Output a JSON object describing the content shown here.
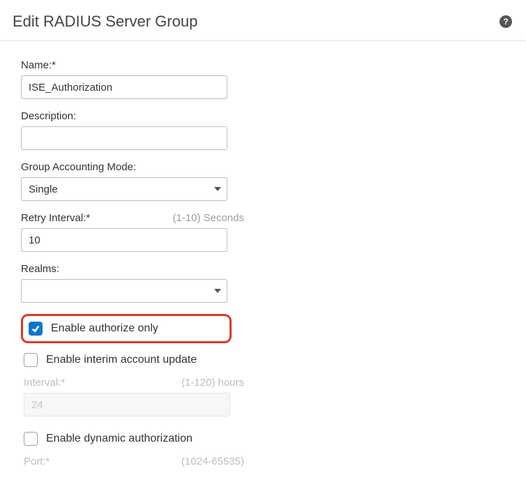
{
  "header": {
    "title": "Edit RADIUS Server Group"
  },
  "fields": {
    "name": {
      "label": "Name:*",
      "value": "ISE_Authorization"
    },
    "description": {
      "label": "Description:",
      "value": ""
    },
    "accounting": {
      "label": "Group Accounting Mode:",
      "value": "Single"
    },
    "retry": {
      "label": "Retry Interval:*",
      "hint": "(1-10) Seconds",
      "value": "10"
    },
    "realms": {
      "label": "Realms:",
      "value": ""
    },
    "authorize_only": {
      "label": "Enable authorize only"
    },
    "interim": {
      "label": "Enable interim account update"
    },
    "interval": {
      "label": "Interval:*",
      "hint": "(1-120) hours",
      "value": "24"
    },
    "dynamic_auth": {
      "label": "Enable dynamic authorization"
    },
    "port": {
      "label": "Port:*",
      "hint": "(1024-65535)"
    }
  }
}
